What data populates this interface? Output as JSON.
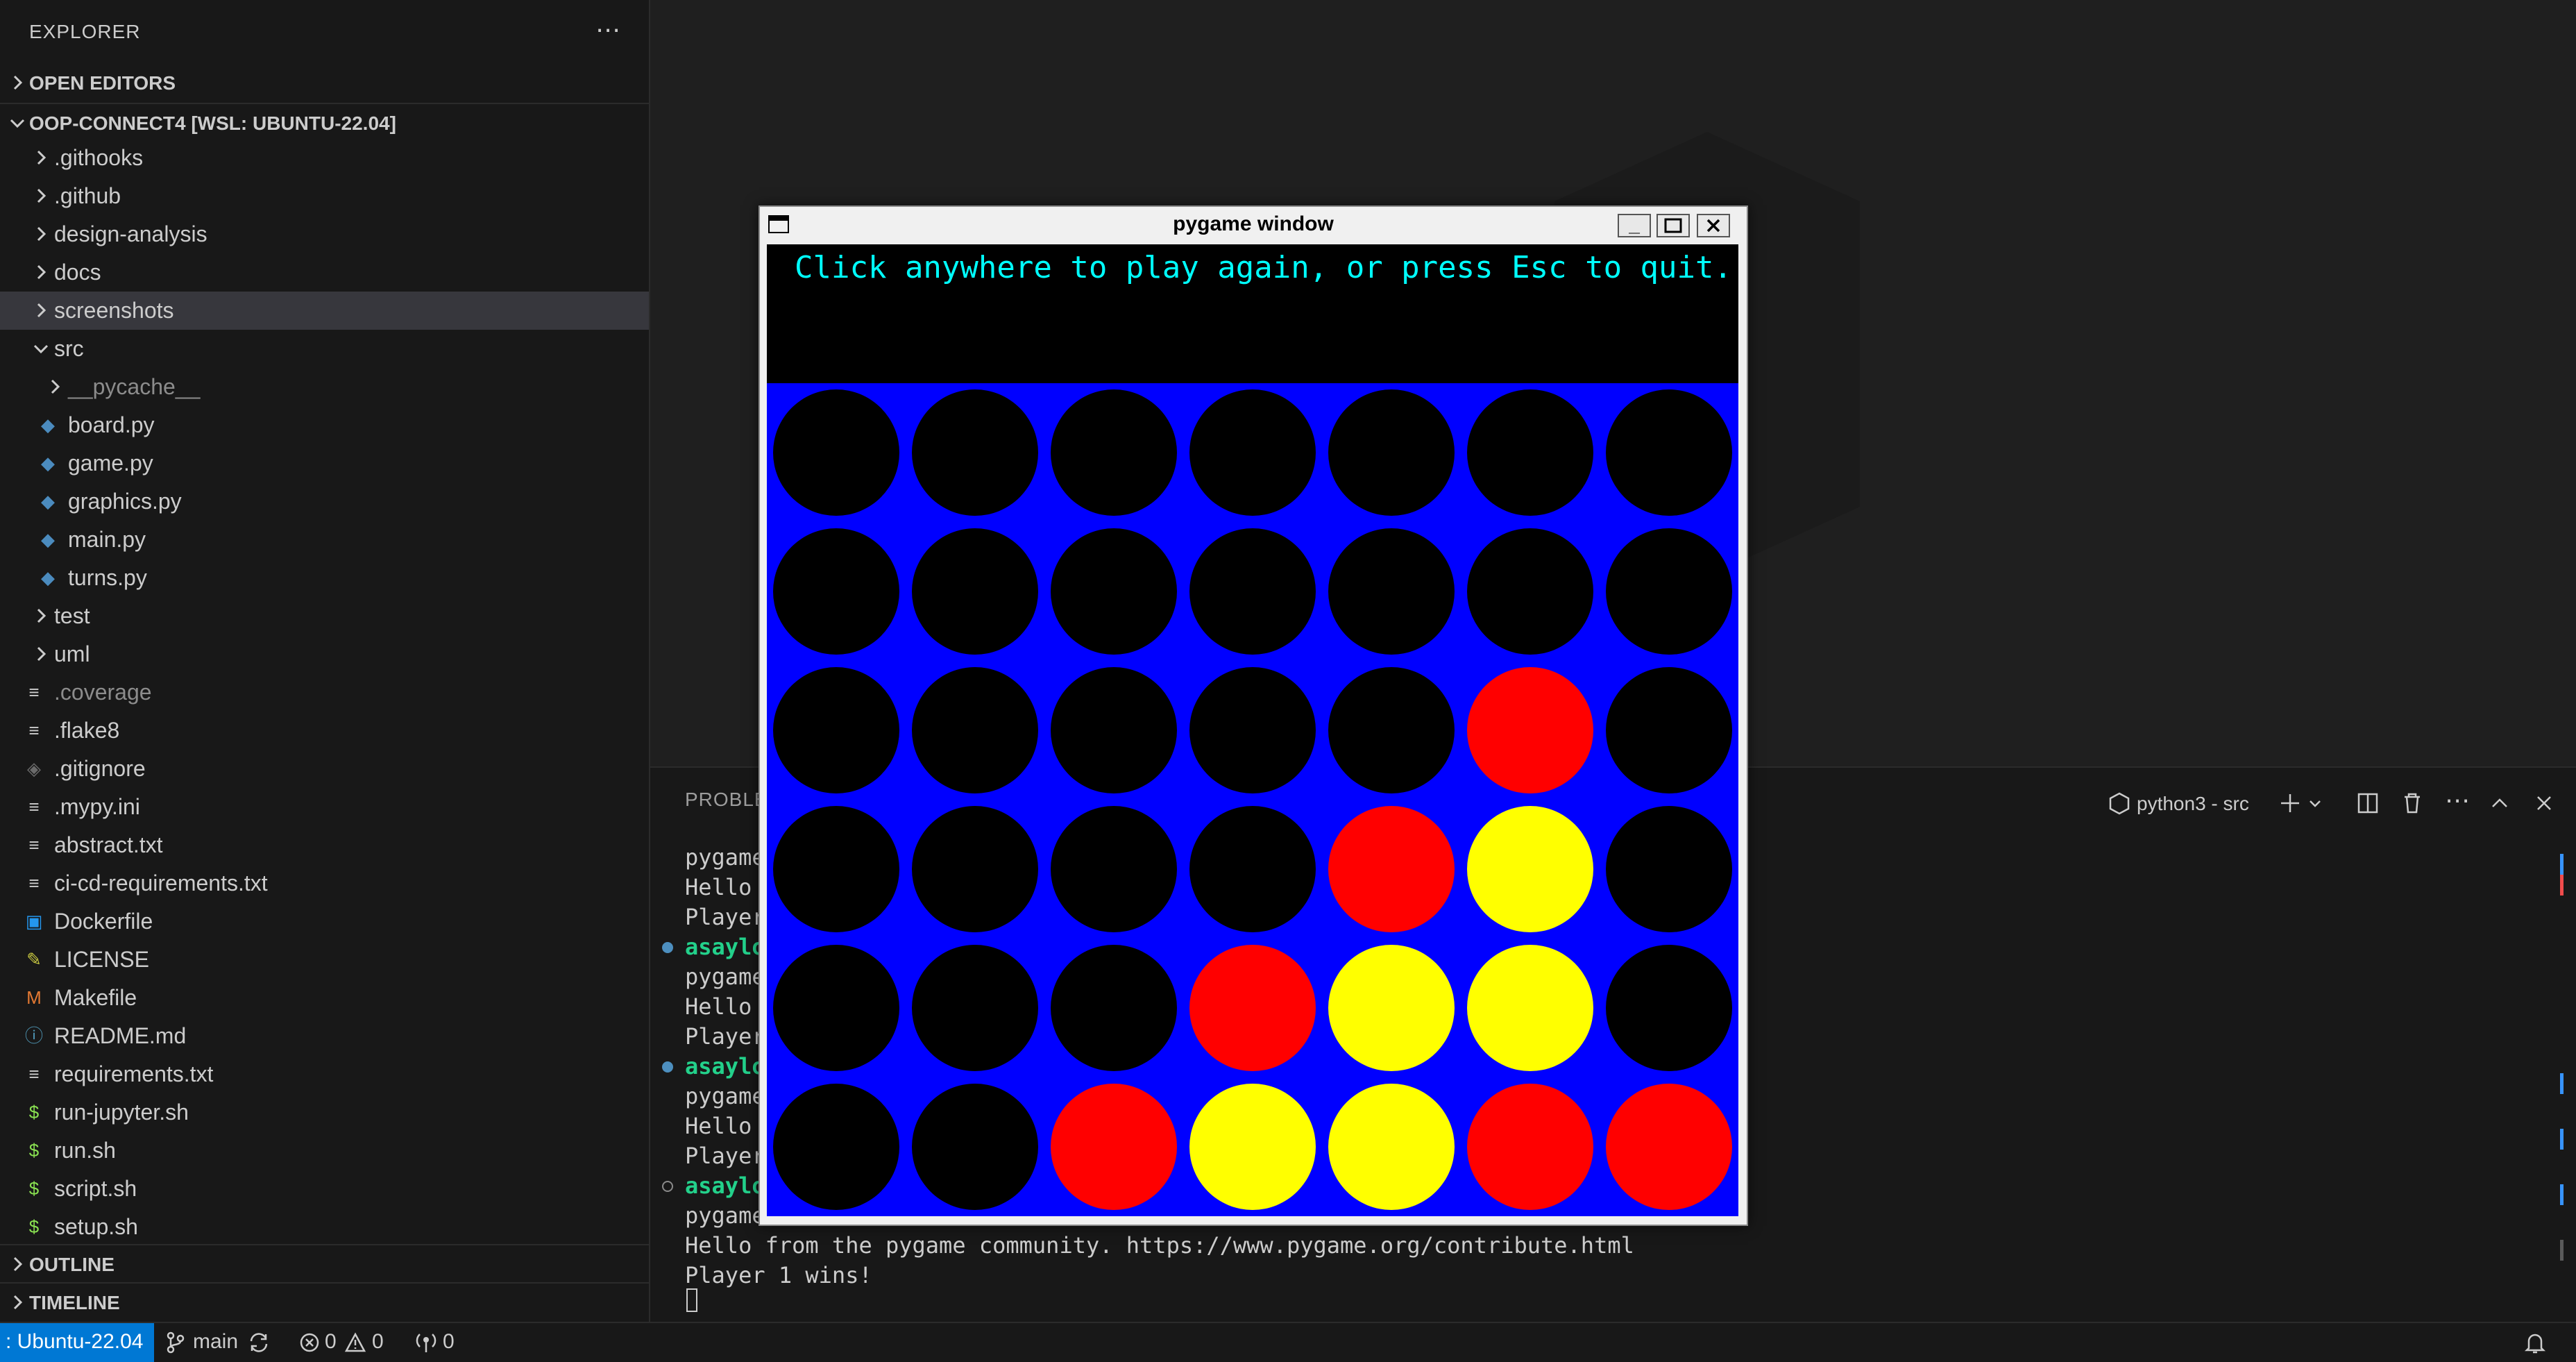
{
  "explorer": {
    "header": "EXPLORER",
    "more_icon": "ellipsis-icon",
    "open_editors": "OPEN EDITORS",
    "workspace": "OOP-CONNECT4 [WSL: UBUNTU-22.04]",
    "items": [
      {
        "label": ".githooks",
        "kind": "folder",
        "depth": 0
      },
      {
        "label": ".github",
        "kind": "folder",
        "depth": 0
      },
      {
        "label": "design-analysis",
        "kind": "folder",
        "depth": 0
      },
      {
        "label": "docs",
        "kind": "folder",
        "depth": 0
      },
      {
        "label": "screenshots",
        "kind": "folder",
        "depth": 0,
        "selected": true
      },
      {
        "label": "src",
        "kind": "folder-open",
        "depth": 0
      },
      {
        "label": "__pycache__",
        "kind": "folder",
        "depth": 1,
        "dim": true
      },
      {
        "label": "board.py",
        "kind": "python",
        "depth": 1
      },
      {
        "label": "game.py",
        "kind": "python",
        "depth": 1
      },
      {
        "label": "graphics.py",
        "kind": "python",
        "depth": 1
      },
      {
        "label": "main.py",
        "kind": "python",
        "depth": 1
      },
      {
        "label": "turns.py",
        "kind": "python",
        "depth": 1
      },
      {
        "label": "test",
        "kind": "folder",
        "depth": 0
      },
      {
        "label": "uml",
        "kind": "folder",
        "depth": 0
      },
      {
        "label": ".coverage",
        "kind": "text",
        "depth": 0,
        "dim": true
      },
      {
        "label": ".flake8",
        "kind": "text",
        "depth": 0
      },
      {
        "label": ".gitignore",
        "kind": "git",
        "depth": 0
      },
      {
        "label": ".mypy.ini",
        "kind": "text",
        "depth": 0
      },
      {
        "label": "abstract.txt",
        "kind": "text",
        "depth": 0
      },
      {
        "label": "ci-cd-requirements.txt",
        "kind": "text",
        "depth": 0
      },
      {
        "label": "Dockerfile",
        "kind": "docker",
        "depth": 0
      },
      {
        "label": "LICENSE",
        "kind": "license",
        "depth": 0
      },
      {
        "label": "Makefile",
        "kind": "make",
        "depth": 0
      },
      {
        "label": "README.md",
        "kind": "info",
        "depth": 0
      },
      {
        "label": "requirements.txt",
        "kind": "text",
        "depth": 0
      },
      {
        "label": "run-jupyter.sh",
        "kind": "shell",
        "depth": 0
      },
      {
        "label": "run.sh",
        "kind": "shell",
        "depth": 0
      },
      {
        "label": "script.sh",
        "kind": "shell",
        "depth": 0
      },
      {
        "label": "setup.sh",
        "kind": "shell",
        "depth": 0
      }
    ],
    "outline": "OUTLINE",
    "timeline": "TIMELINE"
  },
  "panel": {
    "tab": "PROBLEMS",
    "terminal_name": "python3 - src",
    "lines": [
      {
        "text": "pygame",
        "type": "out"
      },
      {
        "text": "Hello",
        "type": "out"
      },
      {
        "text": "Player",
        "type": "out"
      },
      {
        "text": "asaylo",
        "type": "prompt",
        "dot": "blue"
      },
      {
        "text": "pygame",
        "type": "out"
      },
      {
        "text": "Hello",
        "type": "out"
      },
      {
        "text": "Player",
        "type": "out"
      },
      {
        "text": "asaylo",
        "type": "prompt",
        "dot": "blue"
      },
      {
        "text": "pygame",
        "type": "out"
      },
      {
        "text": "Hello",
        "type": "out"
      },
      {
        "text": "Player",
        "type": "out"
      },
      {
        "text": "asaylo",
        "type": "prompt",
        "dot": "hollow"
      },
      {
        "text": "pygame",
        "type": "out"
      },
      {
        "text": "Hello from the pygame community. https://www.pygame.org/contribute.html",
        "type": "out"
      },
      {
        "text": "Player 1 wins!",
        "type": "out"
      }
    ]
  },
  "pygame": {
    "title": "pygame window",
    "message": "Click anywhere to play again, or press Esc to quit.",
    "minimize": "_",
    "board": [
      [
        "empty",
        "empty",
        "empty",
        "empty",
        "empty",
        "empty",
        "empty"
      ],
      [
        "empty",
        "empty",
        "empty",
        "empty",
        "empty",
        "empty",
        "empty"
      ],
      [
        "empty",
        "empty",
        "empty",
        "empty",
        "empty",
        "red",
        "empty"
      ],
      [
        "empty",
        "empty",
        "empty",
        "empty",
        "red",
        "yellow",
        "empty"
      ],
      [
        "empty",
        "empty",
        "empty",
        "red",
        "yellow",
        "yellow",
        "empty"
      ],
      [
        "empty",
        "empty",
        "red",
        "yellow",
        "yellow",
        "red",
        "red"
      ]
    ],
    "colors": {
      "board": "#0000ff",
      "empty": "#000000",
      "red": "#ff0000",
      "yellow": "#ffff00",
      "message": "#00ffff"
    }
  },
  "status": {
    "remote": ": Ubuntu-22.04",
    "branch": "main",
    "errors": "0",
    "warnings": "0",
    "ports": "0"
  }
}
